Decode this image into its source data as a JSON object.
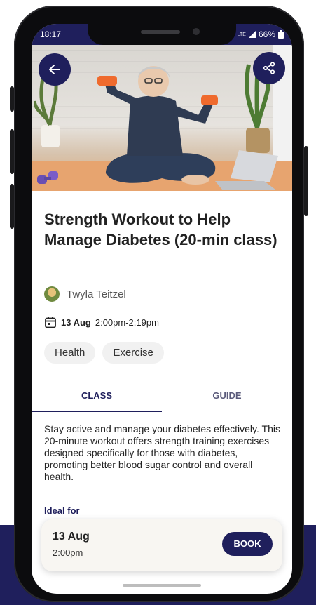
{
  "status_bar": {
    "time": "18:17",
    "network": "LTE",
    "battery": "66%"
  },
  "colors": {
    "brand": "#1f1f5c",
    "accent": "#e8673a",
    "tag_bg": "#f1f1f1"
  },
  "header": {
    "back_icon": "arrow-left-icon",
    "share_icon": "share-icon"
  },
  "event": {
    "title": "Strength Workout to Help Manage Diabetes (20-min class)",
    "instructor": "Twyla Teitzel",
    "date": "13 Aug",
    "time_range": "2:00pm-2:19pm",
    "tags": [
      "Health",
      "Exercise"
    ]
  },
  "tabs": [
    {
      "label": "CLASS",
      "active": true
    },
    {
      "label": "GUIDE",
      "active": false
    }
  ],
  "class_tab": {
    "description": "Stay active and manage your diabetes effectively. This 20-minute workout offers strength training exercises designed specifically for those with diabetes, promoting better blood sugar control and overall health.",
    "section_heading": "Ideal for"
  },
  "booking": {
    "date": "13 Aug",
    "time": "2:00pm",
    "button_label": "BOOK"
  }
}
